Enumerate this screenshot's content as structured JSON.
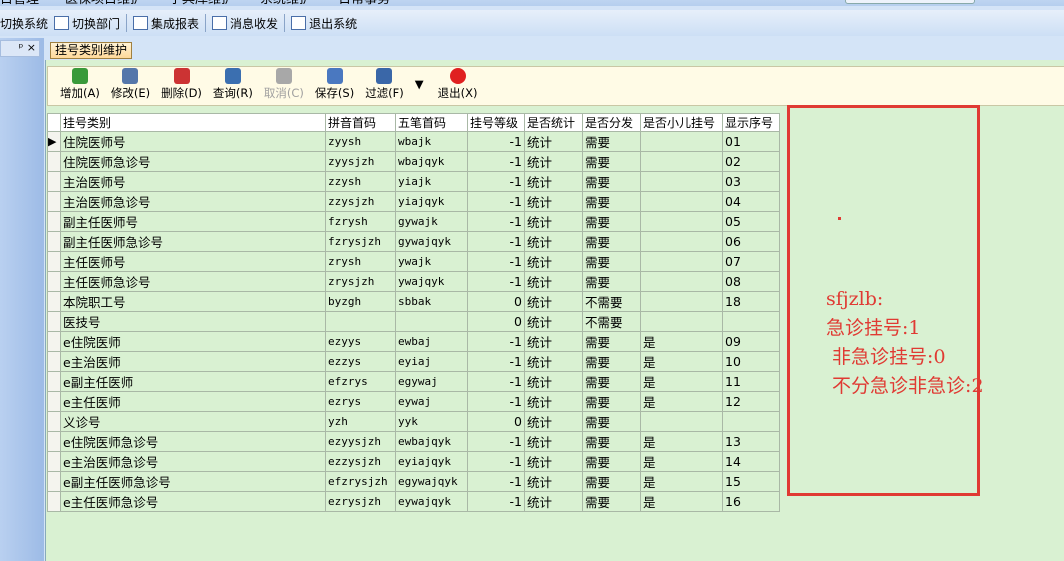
{
  "menu": [
    "目管理",
    "医保项目维护",
    "字典库维护",
    "系统维护",
    "日常事务"
  ],
  "quickbar": [
    {
      "label": "切换系统",
      "icon": "switch-system-icon"
    },
    {
      "label": "切换部门",
      "icon": "switch-department-icon"
    },
    {
      "label": "集成报表",
      "icon": "report-icon"
    },
    {
      "label": "消息收发",
      "icon": "info-icon"
    },
    {
      "label": "退出系统",
      "icon": "exit-system-icon"
    }
  ],
  "panel": {
    "pin": "ᵖ",
    "close": "×"
  },
  "tab": "挂号类别维护",
  "toolbar": [
    {
      "label": "增加(A)",
      "icon": "add-icon",
      "color": "#3a9a3a",
      "enabled": true
    },
    {
      "label": "修改(E)",
      "icon": "edit-icon",
      "color": "#5577aa",
      "enabled": true
    },
    {
      "label": "删除(D)",
      "icon": "delete-icon",
      "color": "#cc3333",
      "enabled": true
    },
    {
      "label": "查询(R)",
      "icon": "query-icon",
      "color": "#3b6fb0",
      "enabled": true
    },
    {
      "label": "取消(C)",
      "icon": "cancel-icon",
      "color": "#a8a8a8",
      "enabled": false
    },
    {
      "label": "保存(S)",
      "icon": "save-icon",
      "color": "#4a78c0",
      "enabled": true
    },
    {
      "label": "过滤(F)",
      "icon": "filter-icon",
      "color": "#3a67a8",
      "enabled": true
    },
    {
      "label": "▼",
      "icon": "dropdown-arrow-icon",
      "color": "",
      "enabled": true
    },
    {
      "label": "退出(X)",
      "icon": "exit-icon",
      "color": "#e02020",
      "enabled": true
    }
  ],
  "grid": {
    "columns": [
      "挂号类别",
      "拼音首码",
      "五笔首码",
      "挂号等级",
      "是否统计",
      "是否分发",
      "是否小儿挂号",
      "显示序号"
    ],
    "rows": [
      [
        "住院医师号",
        "zyysh",
        "wbajk",
        "-1",
        "统计",
        "需要",
        "",
        "01"
      ],
      [
        "住院医师急诊号",
        "zyysjzh",
        "wbajqyk",
        "-1",
        "统计",
        "需要",
        "",
        "02"
      ],
      [
        "主治医师号",
        "zzysh",
        "yiajk",
        "-1",
        "统计",
        "需要",
        "",
        "03"
      ],
      [
        "主治医师急诊号",
        "zzysjzh",
        "yiajqyk",
        "-1",
        "统计",
        "需要",
        "",
        "04"
      ],
      [
        "副主任医师号",
        "fzrysh",
        "gywajk",
        "-1",
        "统计",
        "需要",
        "",
        "05"
      ],
      [
        "副主任医师急诊号",
        "fzrysjzh",
        "gywajqyk",
        "-1",
        "统计",
        "需要",
        "",
        "06"
      ],
      [
        "主任医师号",
        "zrysh",
        "ywajk",
        "-1",
        "统计",
        "需要",
        "",
        "07"
      ],
      [
        "主任医师急诊号",
        "zrysjzh",
        "ywajqyk",
        "-1",
        "统计",
        "需要",
        "",
        "08"
      ],
      [
        "本院职工号",
        "byzgh",
        "sbbak",
        "0",
        "统计",
        "不需要",
        "",
        "18"
      ],
      [
        "医技号",
        "",
        "",
        "0",
        "统计",
        "不需要",
        "",
        ""
      ],
      [
        "e住院医师",
        "ezyys",
        "ewbaj",
        "-1",
        "统计",
        "需要",
        "是",
        "09"
      ],
      [
        "e主治医师",
        "ezzys",
        "eyiaj",
        "-1",
        "统计",
        "需要",
        "是",
        "10"
      ],
      [
        "e副主任医师",
        "efzrys",
        "egywaj",
        "-1",
        "统计",
        "需要",
        "是",
        "11"
      ],
      [
        "e主任医师",
        "ezrys",
        "eywaj",
        "-1",
        "统计",
        "需要",
        "是",
        "12"
      ],
      [
        "义诊号",
        "yzh",
        "yyk",
        "0",
        "统计",
        "需要",
        "",
        ""
      ],
      [
        "e住院医师急诊号",
        "ezyysjzh",
        "ewbajqyk",
        "-1",
        "统计",
        "需要",
        "是",
        "13"
      ],
      [
        "e主治医师急诊号",
        "ezzysjzh",
        "eyiajqyk",
        "-1",
        "统计",
        "需要",
        "是",
        "14"
      ],
      [
        "e副主任医师急诊号",
        "efzrysjzh",
        "egywajqyk",
        "-1",
        "统计",
        "需要",
        "是",
        "15"
      ],
      [
        "e主任医师急诊号",
        "ezrysjzh",
        "eywajqyk",
        "-1",
        "统计",
        "需要",
        "是",
        "16"
      ]
    ],
    "current_row_marker": "▶"
  },
  "annotation": {
    "text": "sfjzlb:\n急诊挂号:1\n 非急诊挂号:0\n 不分急诊非急诊:2",
    "color": "#e03a33"
  }
}
